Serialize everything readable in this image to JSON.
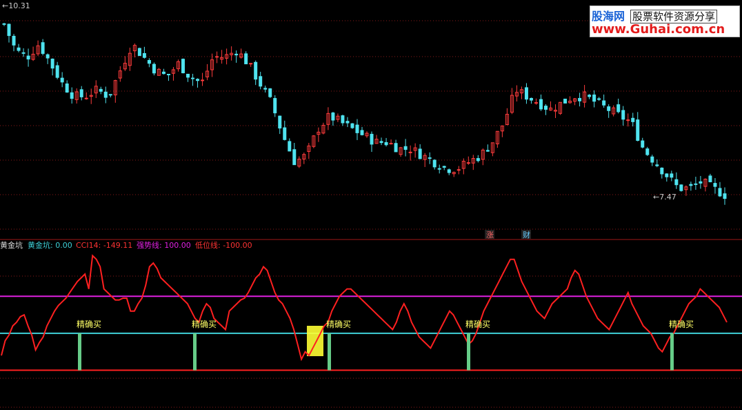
{
  "price_panel": {
    "high_label": "10.31",
    "low_label": "7.47",
    "event_markers": [
      "涨",
      "财"
    ]
  },
  "indicator_panel": {
    "title": "黄金坑",
    "legend": [
      {
        "label": "黄金坑",
        "value": "0.00",
        "color": "#3fd0d8"
      },
      {
        "label": "CCI14",
        "value": "-149.11",
        "color": "#ff3333"
      },
      {
        "label": "强势线",
        "value": "100.00",
        "color": "#e020e0"
      },
      {
        "label": "低位线",
        "value": "-100.00",
        "color": "#ff3333"
      }
    ],
    "buy_signal_label": "精确买",
    "buy_signal_count": 5
  },
  "watermark": {
    "brand": "股海网",
    "tagline": "股票软件资源分享",
    "url": "www.Guhai.com.cn"
  },
  "colors": {
    "background": "#000000",
    "up_candle": "#ff3c3c",
    "down_candle": "#4fe3ef",
    "grid": "#8b1a1a",
    "cci_line": "#ff2020",
    "strong_line": "#e020e0",
    "mid_line": "#3fd0d8",
    "low_line": "#ff2020",
    "signal_bar": "#66cc88",
    "signal_text": "#ffff66",
    "highlight_box": "#ffff33"
  },
  "chart_data": {
    "type": "candlestick",
    "price_high": 10.31,
    "price_low": 7.47,
    "indicator": {
      "name": "CCI14",
      "ylim": [
        -200,
        220
      ],
      "strong_line": 100,
      "zero_line": 0,
      "low_line": -100,
      "values": [
        -60,
        -20,
        -5,
        20,
        30,
        45,
        50,
        20,
        -5,
        -45,
        -25,
        -10,
        20,
        40,
        60,
        75,
        85,
        95,
        110,
        125,
        140,
        150,
        160,
        120,
        210,
        200,
        180,
        120,
        110,
        100,
        90,
        90,
        95,
        95,
        60,
        60,
        80,
        95,
        130,
        180,
        190,
        175,
        150,
        140,
        130,
        120,
        110,
        100,
        90,
        80,
        60,
        40,
        30,
        60,
        80,
        70,
        40,
        30,
        20,
        10,
        60,
        70,
        80,
        90,
        95,
        110,
        130,
        150,
        160,
        180,
        170,
        140,
        110,
        90,
        80,
        60,
        40,
        10,
        -30,
        -70,
        -50,
        -60,
        -40,
        -20,
        0,
        20,
        30,
        60,
        80,
        100,
        110,
        120,
        120,
        110,
        100,
        90,
        80,
        70,
        60,
        50,
        40,
        30,
        20,
        10,
        30,
        60,
        80,
        60,
        30,
        10,
        -10,
        -20,
        -30,
        -40,
        -20,
        0,
        20,
        40,
        60,
        50,
        30,
        10,
        -10,
        -30,
        -20,
        0,
        30,
        60,
        80,
        100,
        120,
        140,
        160,
        180,
        200,
        200,
        170,
        140,
        120,
        100,
        80,
        60,
        50,
        40,
        60,
        80,
        90,
        100,
        110,
        120,
        150,
        170,
        160,
        130,
        100,
        80,
        60,
        40,
        30,
        20,
        10,
        30,
        50,
        70,
        90,
        110,
        80,
        60,
        40,
        20,
        10,
        0,
        -20,
        -40,
        -50,
        -30,
        -10,
        0,
        20,
        40,
        60,
        80,
        90,
        100,
        120,
        110,
        100,
        90,
        80,
        70,
        50,
        30
      ]
    },
    "buy_signals": 5
  }
}
